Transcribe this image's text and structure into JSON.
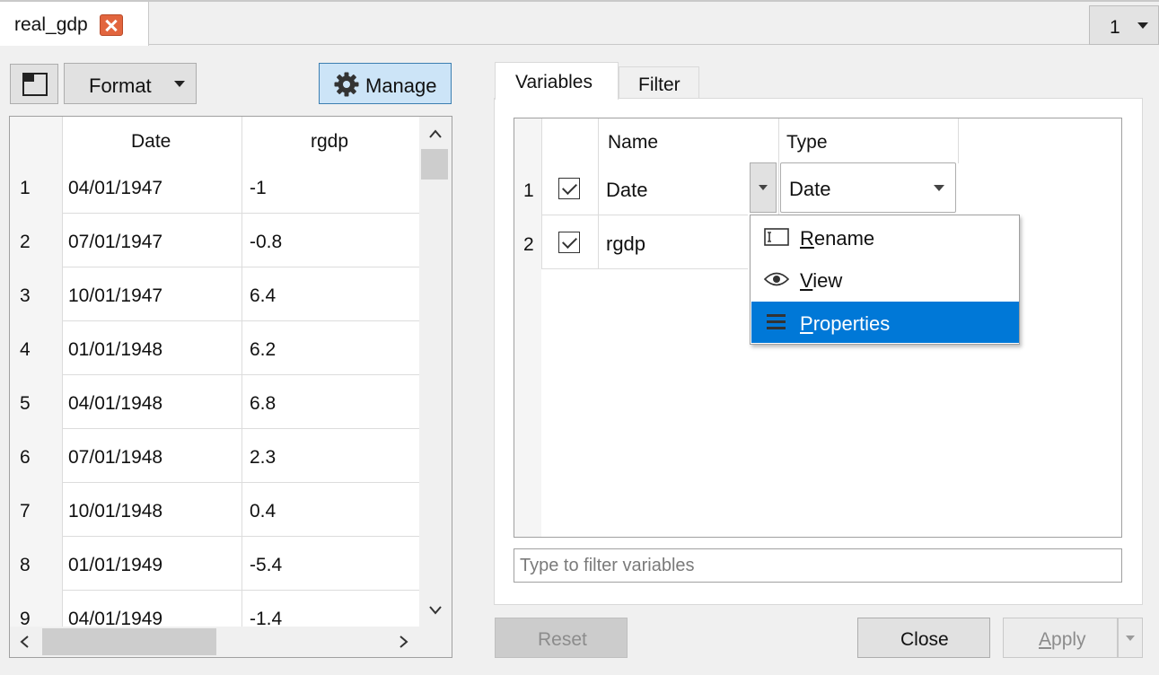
{
  "document_tab": {
    "label": "real_gdp"
  },
  "page_selector": {
    "value": "1"
  },
  "toolbar": {
    "format_label": "Format",
    "manage_label": "Manage"
  },
  "data_grid": {
    "columns": [
      "Date",
      "rgdp"
    ],
    "rows": [
      {
        "n": "1",
        "date": "04/01/1947",
        "rgdp": "-1"
      },
      {
        "n": "2",
        "date": "07/01/1947",
        "rgdp": "-0.8"
      },
      {
        "n": "3",
        "date": "10/01/1947",
        "rgdp": "6.4"
      },
      {
        "n": "4",
        "date": "01/01/1948",
        "rgdp": "6.2"
      },
      {
        "n": "5",
        "date": "04/01/1948",
        "rgdp": "6.8"
      },
      {
        "n": "6",
        "date": "07/01/1948",
        "rgdp": "2.3"
      },
      {
        "n": "7",
        "date": "10/01/1948",
        "rgdp": "0.4"
      },
      {
        "n": "8",
        "date": "01/01/1949",
        "rgdp": "-5.4"
      },
      {
        "n": "9",
        "date": "04/01/1949",
        "rgdp": "-1.4"
      }
    ]
  },
  "right_tabs": [
    {
      "label": "Variables"
    },
    {
      "label": "Filter"
    }
  ],
  "variables_table": {
    "headers": {
      "name": "Name",
      "type": "Type"
    },
    "rows": [
      {
        "n": "1",
        "name": "Date",
        "type": "Date"
      },
      {
        "n": "2",
        "name": "rgdp"
      }
    ]
  },
  "context_menu": {
    "items": [
      {
        "label": "Rename",
        "mnemonic": "R",
        "rest": "ename",
        "icon": "rename-icon"
      },
      {
        "label": "View",
        "mnemonic": "V",
        "rest": "iew",
        "icon": "eye-icon"
      },
      {
        "label": "Properties",
        "mnemonic": "P",
        "rest": "roperties",
        "icon": "list-icon"
      }
    ]
  },
  "filter": {
    "placeholder": "Type to filter variables"
  },
  "buttons": {
    "reset": "Reset",
    "close": "Close",
    "apply_mnemonic": "A",
    "apply_rest": "pply"
  },
  "colors": {
    "accent": "#0078d7",
    "manage_bg": "#cce4f7",
    "close_icon": "#e2653e"
  }
}
